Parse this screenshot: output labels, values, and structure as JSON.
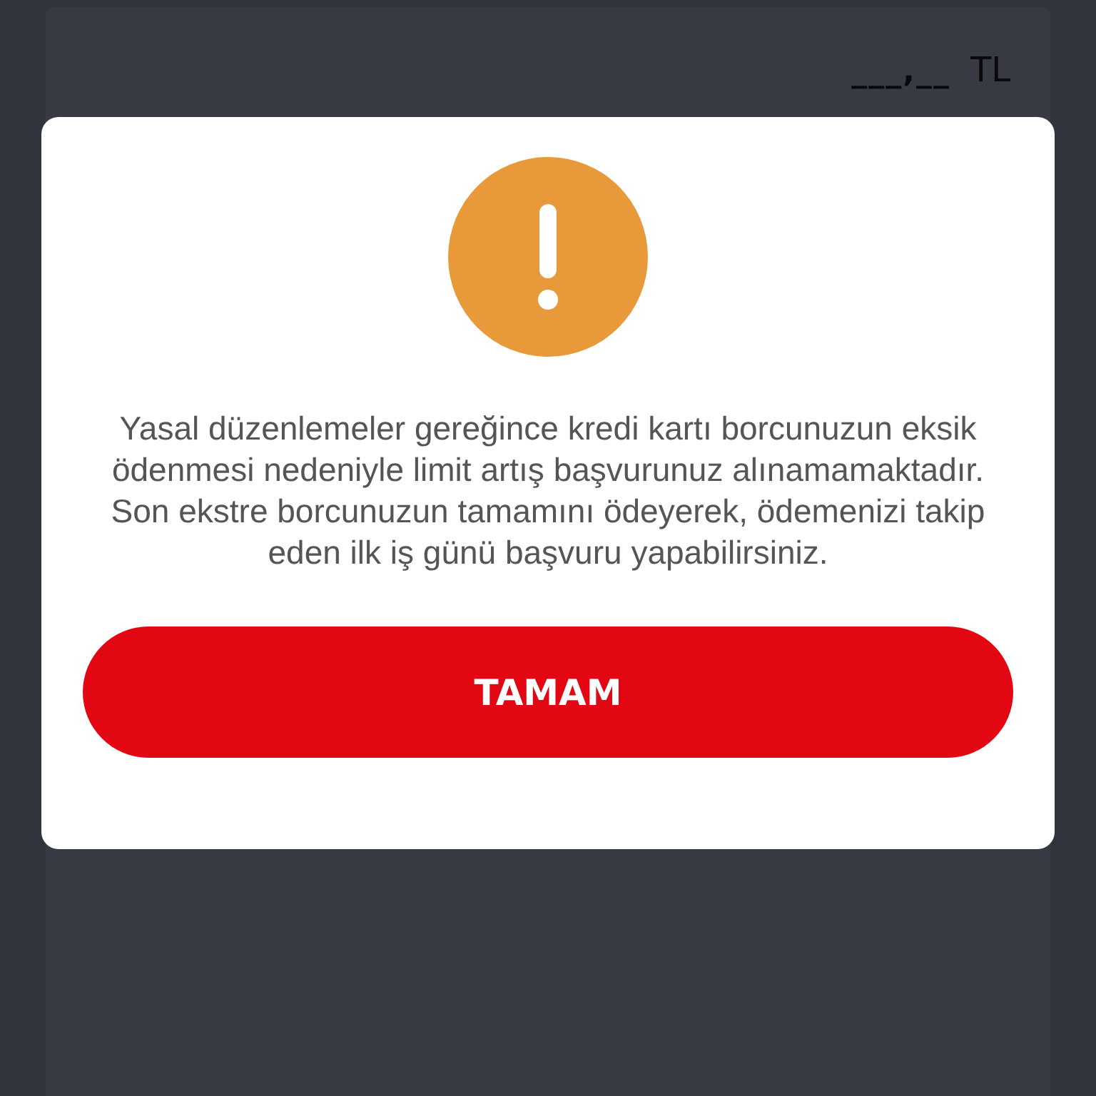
{
  "background_card": {
    "amount": "___,__",
    "currency": "TL"
  },
  "dialog": {
    "message": "Yasal düzenlemeler gereğince kredi kartı borcunuzun eksik ödenmesi nedeniyle limit artış başvurunuz alınamamaktadır. Son ekstre borcunuzun tamamını ödeyerek, ödemenizi takip eden ilk iş günü başvuru yapabilirsiniz.",
    "button": "TAMAM"
  }
}
